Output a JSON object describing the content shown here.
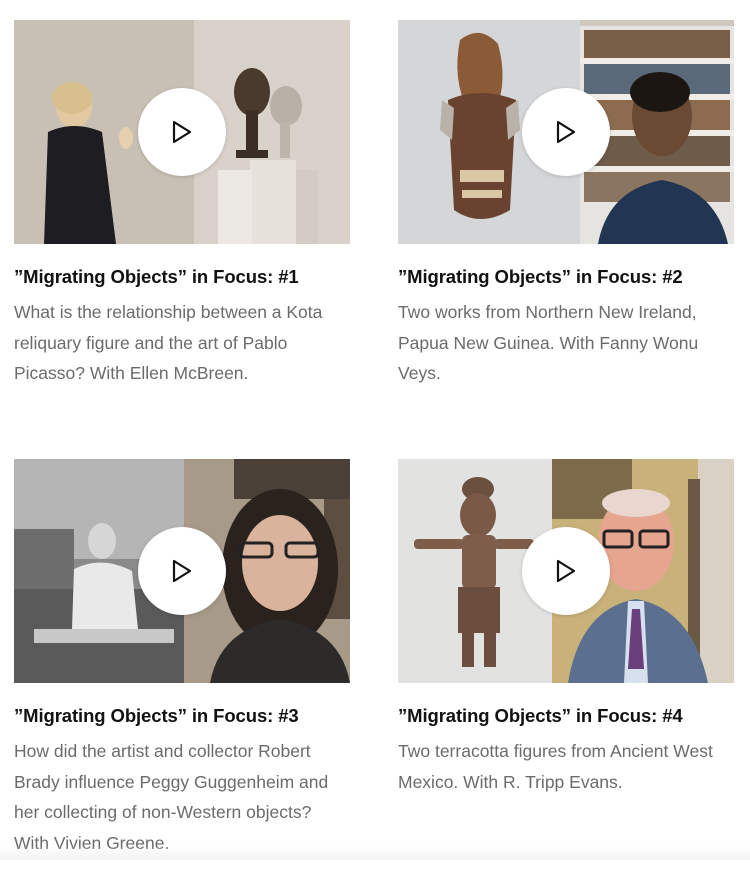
{
  "cards": [
    {
      "title": "”Migrating Objects” in Focus: #1",
      "description": "What is the relationship between a Kota reliquary figure and the art of Pablo Picasso? With Ellen McBreen."
    },
    {
      "title": "”Migrating Objects” in Focus: #2",
      "description": "Two works from Northern New Ireland, Papua New Guinea. With Fanny Wonu Veys."
    },
    {
      "title": "”Migrating Objects” in Focus: #3",
      "description": "How did the artist and collector Robert Brady influence Peggy Guggenheim and her collecting of non-Western objects? With Vivien Greene."
    },
    {
      "title": "”Migrating Objects” in Focus: #4",
      "description": "Two terracotta figures from Ancient West Mexico. With R. Tripp Evans."
    }
  ],
  "icons": {
    "play": "play-icon"
  }
}
